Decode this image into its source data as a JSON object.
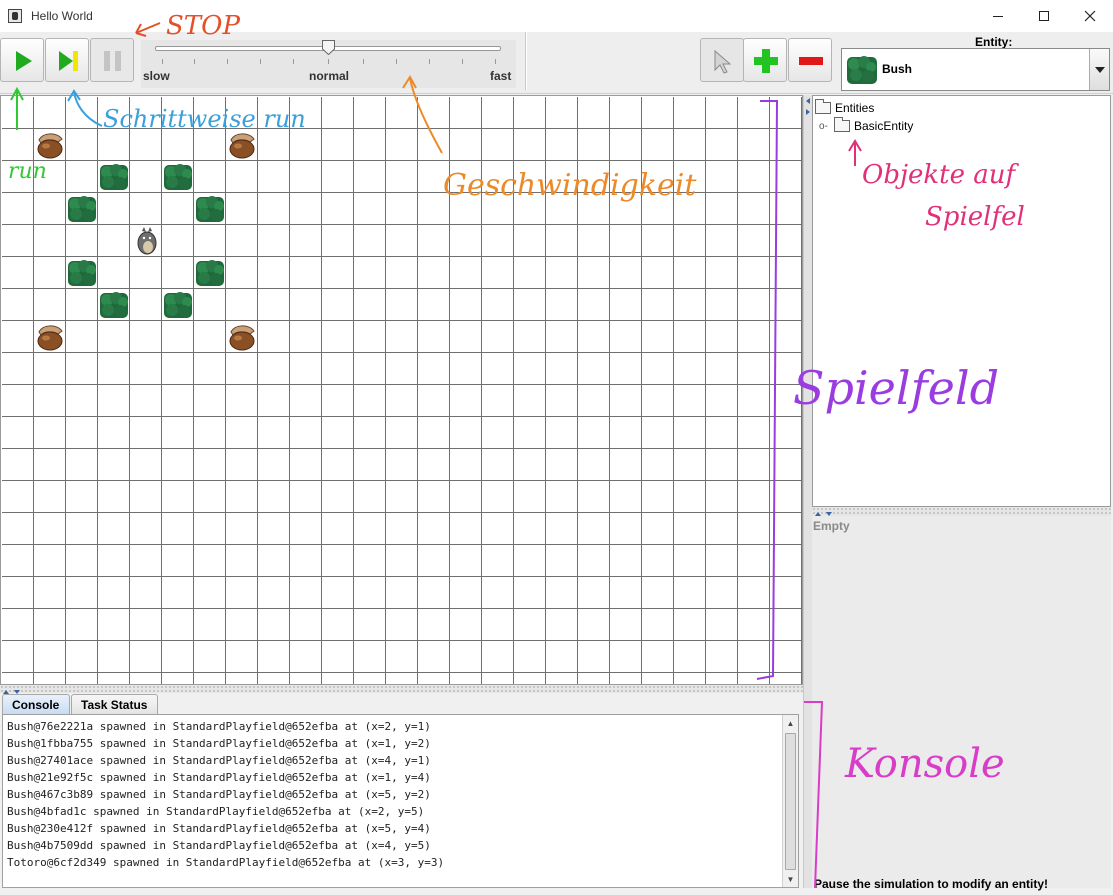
{
  "window": {
    "title": "Hello World"
  },
  "toolbar": {
    "speed_labels": {
      "slow": "slow",
      "normal": "normal",
      "fast": "fast"
    },
    "speed_level": 0.5,
    "icons": [
      "play-icon",
      "step-icon",
      "pause-icon",
      "pointer-icon",
      "plus-icon",
      "minus-icon"
    ],
    "colors": {
      "run": "#1faa1f",
      "step_bar": "#f2e600",
      "add": "#22c422",
      "remove": "#e01818"
    }
  },
  "entity": {
    "label": "Entity:",
    "selected": "Bush"
  },
  "playfield": {
    "grid_cols": 25,
    "grid_rows": 18,
    "entities": [
      {
        "type": "nut",
        "x": 1,
        "y": 1
      },
      {
        "type": "nut",
        "x": 7,
        "y": 1
      },
      {
        "type": "bush",
        "x": 3,
        "y": 2
      },
      {
        "type": "bush",
        "x": 5,
        "y": 2
      },
      {
        "type": "bush",
        "x": 2,
        "y": 3
      },
      {
        "type": "bush",
        "x": 6,
        "y": 3
      },
      {
        "type": "totoro",
        "x": 4,
        "y": 4
      },
      {
        "type": "bush",
        "x": 2,
        "y": 5
      },
      {
        "type": "bush",
        "x": 6,
        "y": 5
      },
      {
        "type": "bush",
        "x": 3,
        "y": 6
      },
      {
        "type": "bush",
        "x": 5,
        "y": 6
      },
      {
        "type": "nut",
        "x": 1,
        "y": 7
      },
      {
        "type": "nut",
        "x": 7,
        "y": 7
      }
    ]
  },
  "tree": {
    "root": "Entities",
    "child": "BasicEntity"
  },
  "inspector": {
    "empty": "Empty",
    "hint": "Pause the simulation to modify an entity!"
  },
  "console": {
    "tabs": [
      "Console",
      "Task Status"
    ],
    "lines": [
      "Bush@76e2221a spawned in StandardPlayfield@652efba at (x=2, y=1)",
      "Bush@1fbba755 spawned in StandardPlayfield@652efba at (x=1, y=2)",
      "Bush@27401ace spawned in StandardPlayfield@652efba at (x=4, y=1)",
      "Bush@21e92f5c spawned in StandardPlayfield@652efba at (x=1, y=4)",
      "Bush@467c3b89 spawned in StandardPlayfield@652efba at (x=5, y=2)",
      "Bush@4bfad1c spawned in StandardPlayfield@652efba at (x=2, y=5)",
      "Bush@230e412f spawned in StandardPlayfield@652efba at (x=5, y=4)",
      "Bush@4b7509dd spawned in StandardPlayfield@652efba at (x=4, y=5)",
      "Totoro@6cf2d349 spawned in StandardPlayfield@652efba at (x=3, y=3)"
    ]
  },
  "annotations": {
    "stop": "STOP",
    "step": "Schrittweise run",
    "run": "run",
    "speed": "Geschwindigkeit",
    "objects_1": "Objekte auf",
    "objects_2": "Spielfel",
    "playfield": "Spielfeld",
    "console": "Konsole",
    "colors": {
      "red": "#e3502a",
      "blue": "#3aa0dc",
      "green": "#32c832",
      "orange": "#ec8a2a",
      "pink": "#e0307a",
      "purple": "#9a3ce0",
      "magenta": "#d93cc8"
    }
  }
}
